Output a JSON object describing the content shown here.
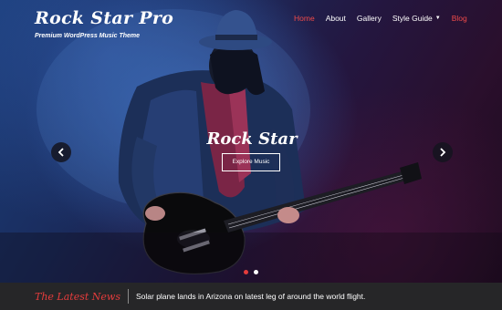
{
  "header": {
    "site_title": "Rock Star Pro",
    "tagline": "Premium WordPress Music Theme"
  },
  "nav": {
    "items": [
      {
        "label": "Home",
        "active": true
      },
      {
        "label": "About"
      },
      {
        "label": "Gallery"
      },
      {
        "label": "Style Guide",
        "has_dropdown": true
      },
      {
        "label": "Blog"
      }
    ]
  },
  "slider": {
    "title": "Rock Star",
    "button_label": "Explore Music",
    "slide_count": 2,
    "active_slide": 1
  },
  "news": {
    "label": "The Latest News",
    "headline": "Solar plane lands in Arizona on latest leg of around the world flight."
  },
  "colors": {
    "accent": "#e53c3c",
    "news_bar": "#262628",
    "text": "#ffffff"
  },
  "icons": {
    "prev": "chevron-left-icon",
    "next": "chevron-right-icon",
    "dropdown": "caret-down-icon"
  }
}
